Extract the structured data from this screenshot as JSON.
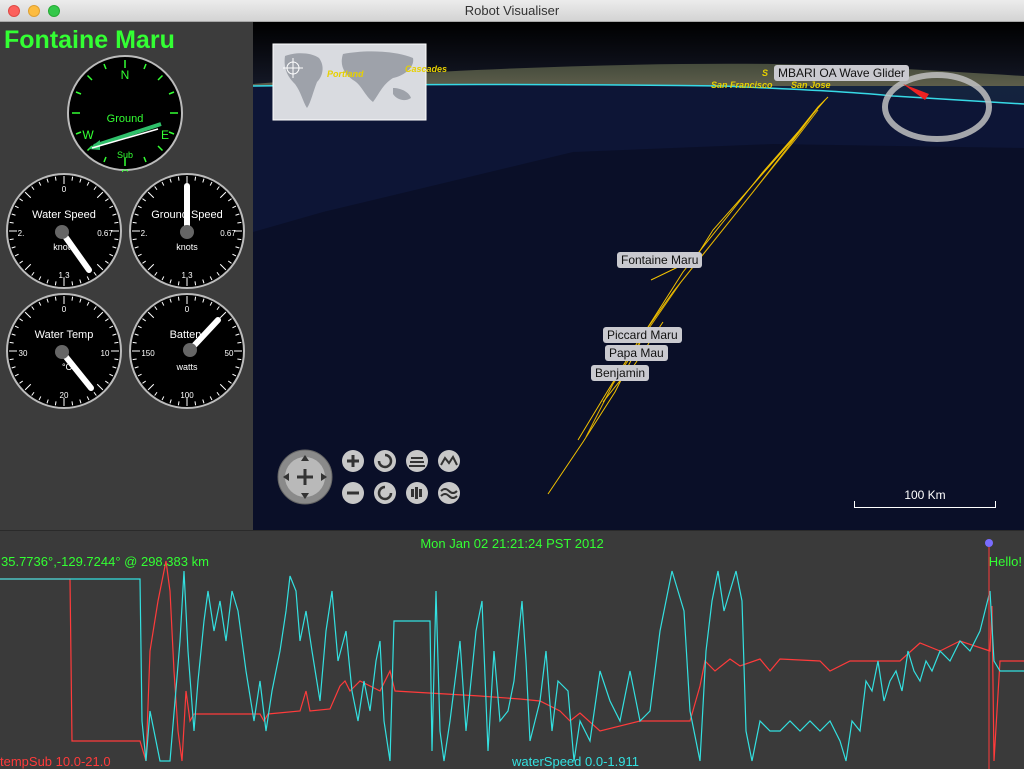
{
  "window": {
    "title": "Robot Visualiser"
  },
  "robot": {
    "name": "Fontaine Maru"
  },
  "gauges": {
    "compass": {
      "n": "N",
      "e": "E",
      "s": "S",
      "w": "W",
      "ground": "Ground",
      "sub": "Sub"
    },
    "water_speed": {
      "label": "Water Speed",
      "unit": "knots",
      "top": "0",
      "right": "0.67",
      "left": "2.",
      "bottom": "1.3"
    },
    "ground_speed": {
      "label": "Ground Speed",
      "unit": "knots",
      "top": "0",
      "right": "0.67",
      "left": "2.",
      "bottom": "1.3"
    },
    "water_temp": {
      "label": "Water Temp",
      "unit": "°C",
      "top": "0",
      "right": "10",
      "left": "30",
      "bottom": "20"
    },
    "battery": {
      "label": "Battery",
      "unit": "watts",
      "top": "0",
      "right": "50",
      "left": "150",
      "bottom": "100"
    }
  },
  "map": {
    "labels": {
      "fontaine": "Fontaine Maru",
      "piccard": "Piccard Maru",
      "papa": "Papa Mau",
      "benjamin": "Benjamin",
      "wave_glider": "MBARI OA Wave Glider"
    },
    "places": {
      "portland": "Portland",
      "cascades": "Cascades",
      "sf": "San Francisco",
      "sj": "San Jose",
      "sl": "S"
    },
    "scale": "100 Km"
  },
  "status": {
    "timestamp": "Mon Jan 02 21:21:24 PST 2012",
    "coords": "35.7736°,-129.7244° @ 298.383 km",
    "message": "Hello!"
  },
  "series_legend": {
    "temp": "tempSub 10.0-21.0",
    "speed": "waterSpeed 0.0-1.911"
  },
  "colors": {
    "accent": "#33ff33",
    "temp_line": "#ff3b3b",
    "speed_line": "#33e0e0",
    "track": "#f2c200"
  }
}
